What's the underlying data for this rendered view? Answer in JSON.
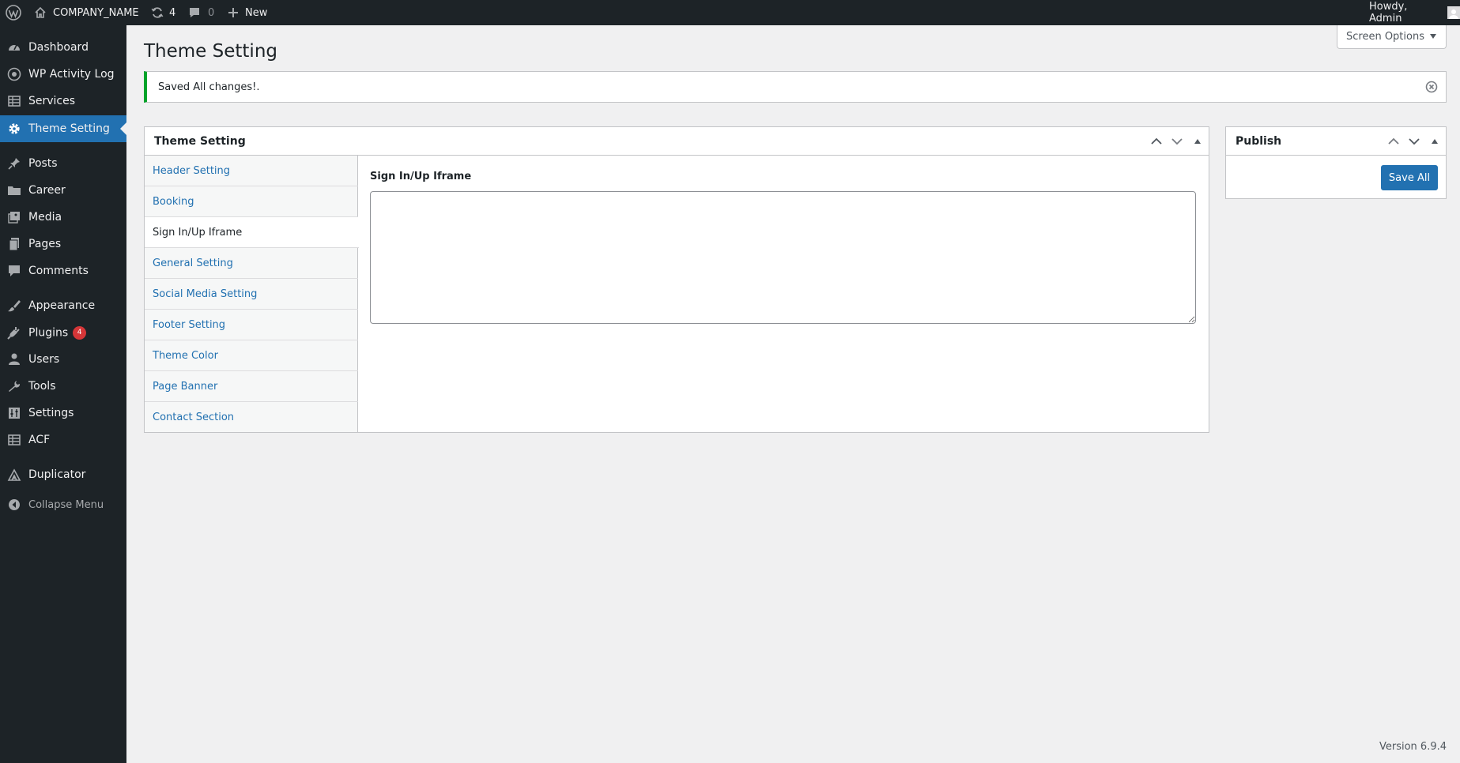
{
  "admin_bar": {
    "site_name": "COMPANY_NAME",
    "updates_count": "4",
    "comments_count": "0",
    "new_label": "New",
    "greeting": "Howdy, Admin"
  },
  "sidebar": {
    "items": [
      {
        "label": "Dashboard",
        "icon": "dashboard-icon"
      },
      {
        "label": "WP Activity Log",
        "icon": "activity-log-icon"
      },
      {
        "label": "Services",
        "icon": "services-icon"
      },
      {
        "label": "Theme Setting",
        "icon": "gear-icon",
        "current": true
      },
      {
        "label": "Posts",
        "icon": "pin-icon"
      },
      {
        "label": "Career",
        "icon": "folder-icon"
      },
      {
        "label": "Media",
        "icon": "media-icon"
      },
      {
        "label": "Pages",
        "icon": "pages-icon"
      },
      {
        "label": "Comments",
        "icon": "comment-icon"
      },
      {
        "label": "Appearance",
        "icon": "brush-icon"
      },
      {
        "label": "Plugins",
        "icon": "plugin-icon",
        "badge": "4"
      },
      {
        "label": "Users",
        "icon": "user-icon"
      },
      {
        "label": "Tools",
        "icon": "wrench-icon"
      },
      {
        "label": "Settings",
        "icon": "sliders-icon"
      },
      {
        "label": "ACF",
        "icon": "table-icon"
      },
      {
        "label": "Duplicator",
        "icon": "duplicator-icon"
      }
    ],
    "collapse_label": "Collapse Menu"
  },
  "screen_options": "Screen Options",
  "page": {
    "title": "Theme Setting"
  },
  "notice": {
    "message": "Saved All changes!."
  },
  "main_box": {
    "title": "Theme Setting",
    "tabs": [
      {
        "label": "Header Setting"
      },
      {
        "label": "Booking"
      },
      {
        "label": "Sign In/Up Iframe",
        "active": true
      },
      {
        "label": "General Setting"
      },
      {
        "label": "Social Media Setting"
      },
      {
        "label": "Footer Setting"
      },
      {
        "label": "Theme Color"
      },
      {
        "label": "Page Banner"
      },
      {
        "label": "Contact Section"
      }
    ],
    "field_label": "Sign In/Up Iframe",
    "field_value": ""
  },
  "publish_box": {
    "title": "Publish",
    "save_label": "Save All"
  },
  "footer": {
    "version": "Version 6.9.4"
  },
  "colors": {
    "admin_bar_bg": "#1d2327",
    "accent": "#2271b1",
    "notice_success": "#00a32a",
    "badge": "#d63638"
  }
}
